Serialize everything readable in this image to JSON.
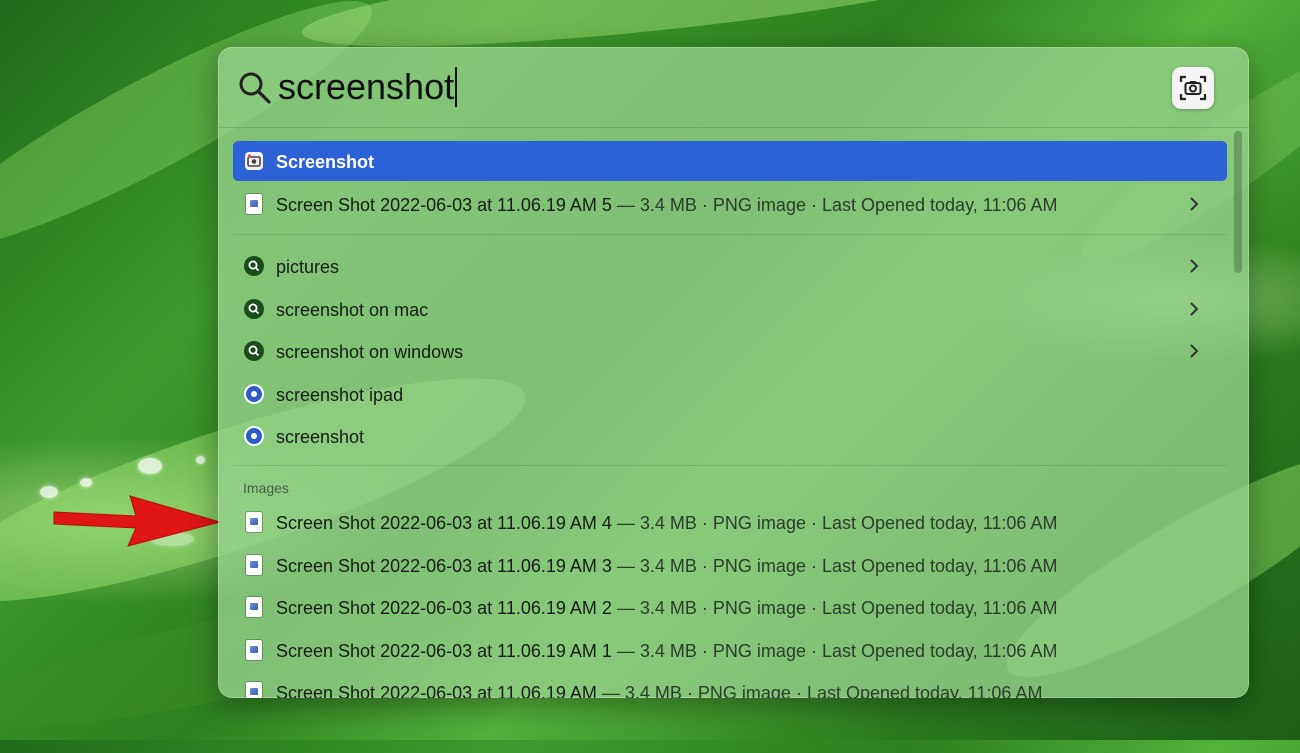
{
  "search": {
    "query": "screenshot",
    "capture_button_icon": "screenshot-capture-icon"
  },
  "top_hits": [
    {
      "title": "Screenshot",
      "meta": "",
      "icon": "screenshot-app-icon",
      "selected": true,
      "chevron": false
    },
    {
      "title": "Screen Shot 2022-06-03 at 11.06.19 AM 5",
      "meta": " — 3.4 MB · PNG image · Last Opened today, 11:06 AM",
      "icon": "image-file-icon",
      "selected": false,
      "chevron": true
    }
  ],
  "suggestions": [
    {
      "title": "pictures",
      "icon": "search-suggestion-icon",
      "chevron": true
    },
    {
      "title": "screenshot on mac",
      "icon": "search-suggestion-icon",
      "chevron": true
    },
    {
      "title": "screenshot on windows",
      "icon": "search-suggestion-icon",
      "chevron": true
    },
    {
      "title": "screenshot ipad",
      "icon": "safari-icon",
      "chevron": false
    },
    {
      "title": "screenshot",
      "icon": "safari-icon",
      "chevron": false
    }
  ],
  "images_section": {
    "label": "Images",
    "items": [
      {
        "title": "Screen Shot 2022-06-03 at 11.06.19 AM 4",
        "meta": " — 3.4 MB · PNG image · Last Opened today, 11:06 AM"
      },
      {
        "title": "Screen Shot 2022-06-03 at 11.06.19 AM 3",
        "meta": " — 3.4 MB · PNG image · Last Opened today, 11:06 AM"
      },
      {
        "title": "Screen Shot 2022-06-03 at 11.06.19 AM 2",
        "meta": " — 3.4 MB · PNG image · Last Opened today, 11:06 AM"
      },
      {
        "title": "Screen Shot 2022-06-03 at 11.06.19 AM 1",
        "meta": " — 3.4 MB · PNG image · Last Opened today, 11:06 AM"
      },
      {
        "title": "Screen Shot 2022-06-03 at 11.06.19 AM",
        "meta": " — 3.4 MB · PNG image · Last Opened today, 11:06 AM"
      }
    ]
  },
  "colors": {
    "selection": "#2d62d6",
    "annotation_arrow": "#e01515"
  }
}
